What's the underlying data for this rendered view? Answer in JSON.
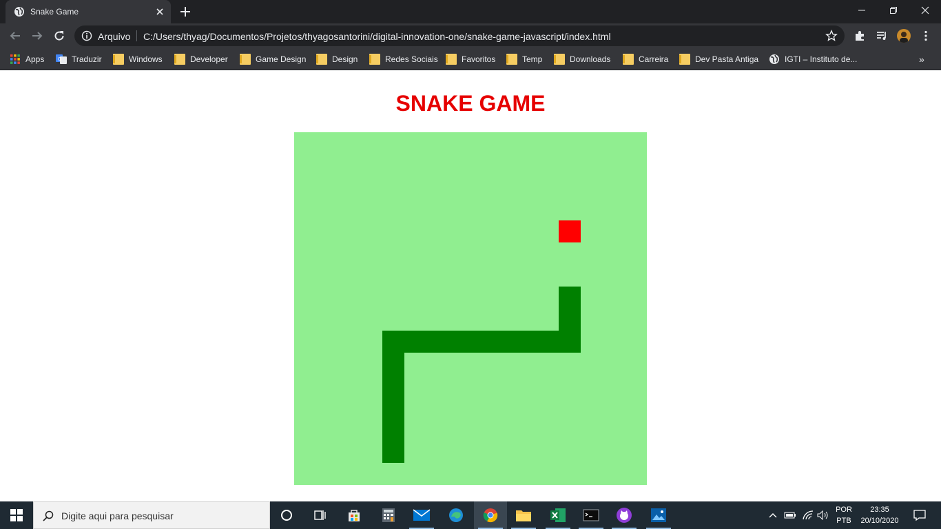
{
  "browser": {
    "tab": {
      "title": "Snake Game"
    },
    "address": {
      "scheme_label": "Arquivo",
      "url": "C:/Users/thyag/Documentos/Projetos/thyagosantorini/digital-innovation-one/snake-game-javascript/index.html"
    },
    "bookmarks": [
      {
        "label": "Apps",
        "icon": "apps-grid-icon"
      },
      {
        "label": "Traduzir",
        "icon": "google-translate-icon"
      },
      {
        "label": "Windows",
        "icon": "folder-icon"
      },
      {
        "label": "Developer",
        "icon": "folder-icon"
      },
      {
        "label": "Game Design",
        "icon": "folder-icon"
      },
      {
        "label": "Design",
        "icon": "folder-icon"
      },
      {
        "label": "Redes Sociais",
        "icon": "folder-icon"
      },
      {
        "label": "Favoritos",
        "icon": "folder-icon"
      },
      {
        "label": "Temp",
        "icon": "folder-icon"
      },
      {
        "label": "Downloads",
        "icon": "folder-icon"
      },
      {
        "label": "Carreira",
        "icon": "folder-icon"
      },
      {
        "label": "Dev Pasta Antiga",
        "icon": "folder-icon"
      },
      {
        "label": "IGTI – Instituto de...",
        "icon": "globe-icon"
      }
    ],
    "bookmarks_overflow": "»"
  },
  "page": {
    "heading": "SNAKE GAME",
    "game": {
      "grid_size": 16,
      "board_color": "#90ee90",
      "snake_color": "#008000",
      "food_color": "#ff0000",
      "food": {
        "col": 12,
        "row": 4
      },
      "snake": [
        {
          "col": 12,
          "row": 7
        },
        {
          "col": 12,
          "row": 8
        },
        {
          "col": 12,
          "row": 9
        },
        {
          "col": 11,
          "row": 9
        },
        {
          "col": 10,
          "row": 9
        },
        {
          "col": 9,
          "row": 9
        },
        {
          "col": 8,
          "row": 9
        },
        {
          "col": 7,
          "row": 9
        },
        {
          "col": 6,
          "row": 9
        },
        {
          "col": 5,
          "row": 9
        },
        {
          "col": 4,
          "row": 9
        },
        {
          "col": 4,
          "row": 10
        },
        {
          "col": 4,
          "row": 11
        },
        {
          "col": 4,
          "row": 12
        },
        {
          "col": 4,
          "row": 13
        },
        {
          "col": 4,
          "row": 14
        }
      ]
    }
  },
  "taskbar": {
    "search_placeholder": "Digite aqui para pesquisar",
    "apps": [
      "cortana-icon",
      "task-view-icon",
      "store-icon",
      "calculator-icon",
      "mail-icon",
      "edge-icon",
      "chrome-icon",
      "file-explorer-icon",
      "excel-icon",
      "terminal-icon",
      "github-desktop-icon",
      "photos-icon"
    ],
    "active_app": "chrome-icon",
    "lang_top": "POR",
    "lang_bottom": "PTB",
    "time": "23:35",
    "date": "20/10/2020"
  }
}
